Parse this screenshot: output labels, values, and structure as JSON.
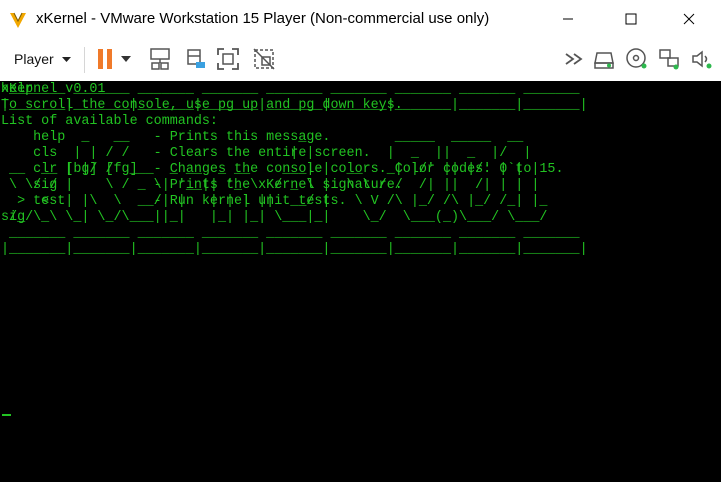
{
  "window": {
    "title": "xKernel - VMware Workstation 15 Player (Non-commercial use only)"
  },
  "toolbar": {
    "player_label": "Player",
    "icons": [
      "pause-icon",
      "send-ctrl-alt-del-icon",
      "removable-devices-icon",
      "fullscreen-icon",
      "unity-icon",
      "forward-icon",
      "hard-disk-icon",
      "cd-dvd-icon",
      "network-adapter-icon",
      "sound-icon"
    ],
    "accent_color": "#f07a2a"
  },
  "console": {
    "text_color": "#22c322",
    "background": "#000000",
    "lines": [
      "help",
      "To scroll the console, use pg up and pg down keys.",
      "List of available commands:",
      "    help           - Prints this message.",
      "    cls            - Clears the entire screen.",
      "    clr [bg] [fg]  - Changes the console colors. Color codes: 0 to 15.",
      "    sig            - Prints the xKernel signature.",
      "    test           - Run kernel unit tests.",
      "sig"
    ],
    "banner": " _______ _______ _______ _______ _______ _______ _______ _______ _______\n|_______|_______|_______|_______|_______|_______|_______|_______|_______|\n\n          _   __                     _           _____  _____  __\n         | | / /                    | |         |  _  ||  _  |/  |\n __  __ | |/ /  ___  _ __  _ __    ___| |  __   _| |/' || |/' |`| |\n \\ \\/ / |    \\ / _ \\| '__|| '_ \\  / _ \\ |  \\ \\ / /  /| ||  /| | | |\n  >  <  | |\\  \\  __/| |   | | | ||  __/ |   \\ V /\\ |_/ /\\ |_/ /_| |_\n /_/\\_\\ \\_| \\_/\\___||_|   |_| |_| \\___|_|    \\_/  \\___(_)\\___/ \\___/\n _______ _______ _______ _______ _______ _______ _______ _______ _______\n|_______|_______|_______|_______|_______|_______|_______|_______|_______|",
    "version": "xKernel v0.01"
  }
}
